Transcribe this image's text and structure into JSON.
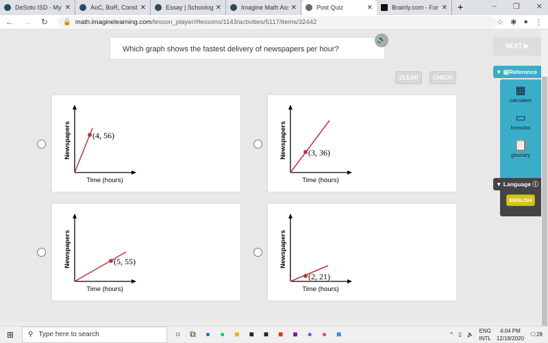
{
  "browser": {
    "tabs": [
      {
        "title": "DeSoto ISD - My Apps",
        "active": false
      },
      {
        "title": "AoC, BoR, Constitution",
        "active": false
      },
      {
        "title": "Essay | Schoology",
        "active": false
      },
      {
        "title": "Imagine Math Assignments",
        "active": false
      },
      {
        "title": "Post Quiz",
        "active": true
      },
      {
        "title": "Brainly.com - For students",
        "active": false
      }
    ],
    "url_host": "math.imaginelearning.com",
    "url_path": "/lesson_player/#lessons/1143/activities/5117/items/32442"
  },
  "quiz": {
    "question": "Which graph shows the fastest delivery of newspapers per hour?",
    "next_label": "NEXT ▶",
    "clear_label": "CLEAR",
    "check_label": "CHECK",
    "accent": "#c0323c",
    "options": [
      {
        "y_label": "Newspapers",
        "x_label": "Time (hours)",
        "point": [
          4,
          56
        ],
        "point_label": "(4, 56)"
      },
      {
        "y_label": "Newspapers",
        "x_label": "Time (hours)",
        "point": [
          3,
          36
        ],
        "point_label": "(3, 36)"
      },
      {
        "y_label": "Newspapers",
        "x_label": "Time (hours)",
        "point": [
          5,
          55
        ],
        "point_label": "(5, 55)"
      },
      {
        "y_label": "Newspapers",
        "x_label": "Time (hours)",
        "point": [
          2,
          21
        ],
        "point_label": "(2, 21)"
      }
    ]
  },
  "sidebar": {
    "reference_label": "Reference",
    "items": [
      {
        "label": "calculator",
        "icon": "calculator-icon"
      },
      {
        "label": "formulas",
        "icon": "formulas-icon"
      },
      {
        "label": "glossary",
        "icon": "glossary-icon"
      }
    ],
    "language_label": "Language",
    "language_value": "ENGLISH",
    "color": "#3aaec8"
  },
  "taskbar": {
    "search_placeholder": "Type here to search",
    "lang1": "ENG",
    "lang2": "INTL",
    "time": "4:04 PM",
    "date": "12/18/2020",
    "notifications": "28"
  }
}
